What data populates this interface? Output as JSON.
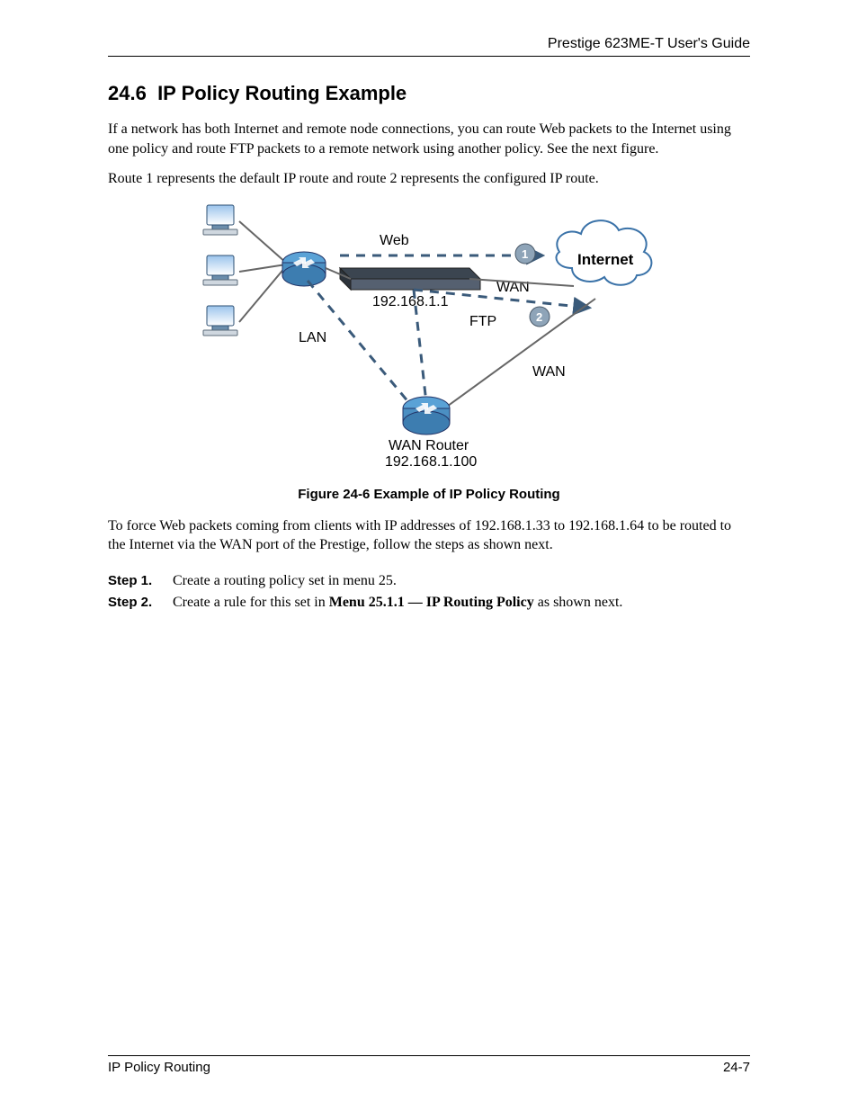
{
  "header": {
    "guide_title": "Prestige 623ME-T User's Guide"
  },
  "section": {
    "number": "24.6",
    "title": "IP Policy Routing Example",
    "para1": "If a network has both Internet and remote node connections, you can route Web packets to the Internet using one policy and route FTP packets to a remote network using another policy. See the next figure.",
    "para2": "Route 1 represents the default IP route and route 2 represents the configured IP route."
  },
  "figure": {
    "labels": {
      "web": "Web",
      "internet": "Internet",
      "wan1": "WAN",
      "ftp": "FTP",
      "lan": "LAN",
      "wan2": "WAN",
      "ip1": "192.168.1.1",
      "wan_router": "WAN Router",
      "ip2": "192.168.1.100",
      "badge1": "1",
      "badge2": "2"
    },
    "caption": "Figure 24-6 Example of IP Policy Routing"
  },
  "post_figure": "To force Web packets coming from clients with IP addresses of 192.168.1.33 to 192.168.1.64 to be routed to the Internet via the WAN port of the Prestige, follow the steps as shown next.",
  "steps": [
    {
      "label": "Step 1.",
      "body_pre": "Create a routing policy set in menu 25.",
      "body_bold": "",
      "body_post": ""
    },
    {
      "label": "Step 2.",
      "body_pre": "Create a rule for this set in ",
      "body_bold": "Menu 25.1.1 — IP Routing Policy",
      "body_post": " as shown next."
    }
  ],
  "footer": {
    "left": "IP Policy Routing",
    "right": "24-7"
  }
}
